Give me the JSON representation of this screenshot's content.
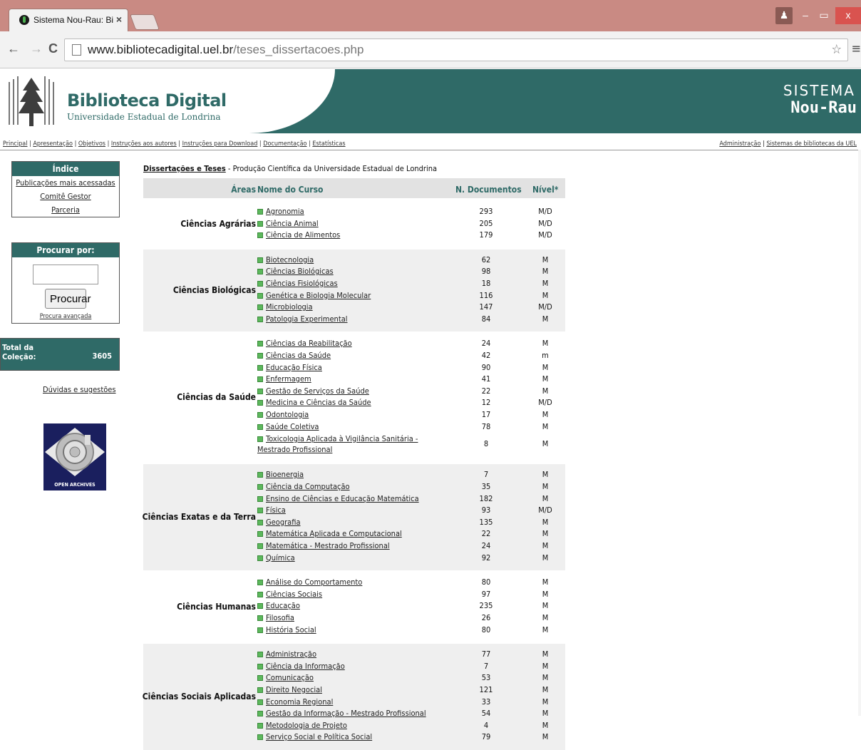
{
  "browser": {
    "tab_title": "Sistema Nou-Rau: Bibliote",
    "tab_close": "×",
    "url_host": "www.bibliotecadigital.uel.br",
    "url_path": "/teses_dissertacoes.php",
    "back_glyph": "←",
    "forward_glyph": "→",
    "reload_glyph": "C",
    "star_glyph": "☆",
    "menu_glyph": "≡",
    "min_glyph": "–",
    "max_glyph": "▭",
    "close_glyph": "x",
    "user_glyph": "♟"
  },
  "header": {
    "title": "Biblioteca Digital",
    "subtitle": "Universidade Estadual de Londrina",
    "system_label": "SISTEMA",
    "system_name": "Nou-Rau"
  },
  "topnav": {
    "items": [
      "Principal",
      "Apresentação",
      "Objetivos",
      "Instruções aos autores",
      "Instruções para Download",
      "Documentação",
      "Estatísticas"
    ],
    "right_items": [
      "Administração",
      "Sistemas de bibliotecas da UEL"
    ]
  },
  "sidebar": {
    "index_title": "Índice",
    "index_links": [
      "Publicações mais acessadas",
      "Comitê Gestor",
      "Parceria"
    ],
    "search_title": "Procurar por:",
    "search_value": "",
    "search_button": "Procurar",
    "advanced_link": "Procura avançada",
    "total_label_1": "Total da",
    "total_label_2": "Coleção:",
    "total_value": "3605",
    "help_link": "Dúvidas e sugestões",
    "open_archives": "OPEN ARCHIVES"
  },
  "main": {
    "title_bold": "Dissertações e Teses",
    "title_rest": " - Produção Científica da Universidade Estadual de Londrina",
    "headers": {
      "areas": "Áreas",
      "curso": "Nome do Curso",
      "docs": "N. Documentos",
      "nivel": "Nível*"
    },
    "areas": [
      {
        "name": "Ciências Agrárias",
        "courses": [
          {
            "name": "Agronomia",
            "docs": "293",
            "level": "M/D"
          },
          {
            "name": "Ciência Animal",
            "docs": "205",
            "level": "M/D"
          },
          {
            "name": "Ciência de Alimentos",
            "docs": "179",
            "level": "M/D"
          }
        ]
      },
      {
        "name": "Ciências Biológicas",
        "courses": [
          {
            "name": "Biotecnologia",
            "docs": "62",
            "level": "M"
          },
          {
            "name": "Ciências Biológicas",
            "docs": "98",
            "level": "M"
          },
          {
            "name": "Ciências Fisiológicas",
            "docs": "18",
            "level": "M"
          },
          {
            "name": "Genética e Biologia Molecular",
            "docs": "116",
            "level": "M"
          },
          {
            "name": "Microbiologia",
            "docs": "147",
            "level": "M/D"
          },
          {
            "name": "Patologia Experimental",
            "docs": "84",
            "level": "M"
          }
        ]
      },
      {
        "name": "Ciências da Saúde",
        "courses": [
          {
            "name": "Ciências da Reabilitação",
            "docs": "24",
            "level": "M"
          },
          {
            "name": "Ciências da Saúde",
            "docs": "42",
            "level": "m"
          },
          {
            "name": "Educação Física",
            "docs": "90",
            "level": "M"
          },
          {
            "name": "Enfermagem",
            "docs": "41",
            "level": "M"
          },
          {
            "name": "Gestão de Serviços da Saúde",
            "docs": "22",
            "level": "M"
          },
          {
            "name": "Medicina e Ciências da Saúde",
            "docs": "12",
            "level": "M/D"
          },
          {
            "name": "Odontologia",
            "docs": "17",
            "level": "M"
          },
          {
            "name": "Saúde Coletiva",
            "docs": "78",
            "level": "M"
          },
          {
            "name": "Toxicologia Aplicada à Vigilância Sanitária - Mestrado Profissional",
            "docs": "8",
            "level": "M"
          }
        ]
      },
      {
        "name": "Ciências Exatas e da Terra",
        "courses": [
          {
            "name": "Bioenergia",
            "docs": "7",
            "level": "M"
          },
          {
            "name": "Ciência da Computação",
            "docs": "35",
            "level": "M"
          },
          {
            "name": "Ensino de Ciências e Educação Matemática",
            "docs": "182",
            "level": "M"
          },
          {
            "name": "Física",
            "docs": "93",
            "level": "M/D"
          },
          {
            "name": "Geografia",
            "docs": "135",
            "level": "M"
          },
          {
            "name": "Matemática Aplicada e Computacional",
            "docs": "22",
            "level": "M"
          },
          {
            "name": "Matemática - Mestrado Profissional",
            "docs": "24",
            "level": "M"
          },
          {
            "name": "Química",
            "docs": "92",
            "level": "M"
          }
        ]
      },
      {
        "name": "Ciências Humanas",
        "courses": [
          {
            "name": "Análise do Comportamento",
            "docs": "80",
            "level": "M"
          },
          {
            "name": "Ciências Sociais",
            "docs": "97",
            "level": "M"
          },
          {
            "name": "Educação",
            "docs": "235",
            "level": "M"
          },
          {
            "name": "Filosofia",
            "docs": "26",
            "level": "M"
          },
          {
            "name": "História Social",
            "docs": "80",
            "level": "M"
          }
        ]
      },
      {
        "name": "Ciências Sociais Aplicadas",
        "courses": [
          {
            "name": "Administração",
            "docs": "77",
            "level": "M"
          },
          {
            "name": "Ciência da Informação",
            "docs": "7",
            "level": "M"
          },
          {
            "name": "Comunicação",
            "docs": "53",
            "level": "M"
          },
          {
            "name": "Direito Negocial",
            "docs": "121",
            "level": "M"
          },
          {
            "name": "Economia Regional",
            "docs": "33",
            "level": "M"
          },
          {
            "name": "Gestão da Informação - Mestrado Profissional",
            "docs": "54",
            "level": "M"
          },
          {
            "name": "Metodologia de Projeto",
            "docs": "4",
            "level": "M"
          },
          {
            "name": "Serviço Social e Política Social",
            "docs": "79",
            "level": "M"
          }
        ]
      }
    ]
  }
}
